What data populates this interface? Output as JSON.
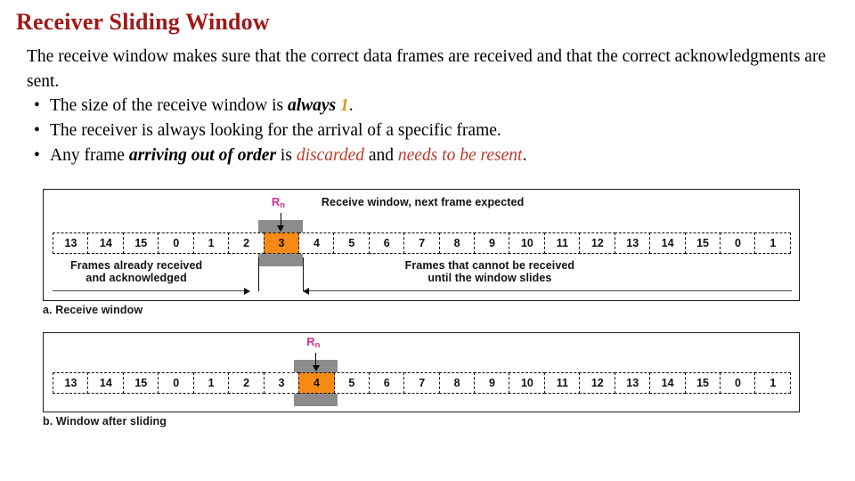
{
  "slide": {
    "title": "Receiver Sliding Window",
    "title_color": "#a01818"
  },
  "body": {
    "intro": "The receive window makes sure that the correct data frames are received and that the correct acknowledgments are sent.",
    "bullet_mark": "•",
    "bullets": [
      {
        "id": "size",
        "parts": [
          {
            "text": "The size of the receive window is ",
            "style": "normal"
          },
          {
            "text": "always ",
            "style": "bold-italic"
          },
          {
            "text": "1",
            "style": "gold-bold-italic"
          },
          {
            "text": ".",
            "style": "normal"
          }
        ]
      },
      {
        "id": "looking",
        "parts": [
          {
            "text": "The receiver is always looking for the arrival of a specific frame.",
            "style": "normal"
          }
        ]
      },
      {
        "id": "out-of-order",
        "parts": [
          {
            "text": "Any frame ",
            "style": "normal"
          },
          {
            "text": "arriving out of order",
            "style": "bold-italic"
          },
          {
            "text": " is ",
            "style": "normal"
          },
          {
            "text": "discarded",
            "style": "red-italic"
          },
          {
            "text": " and ",
            "style": "normal"
          },
          {
            "text": "needs to be resent",
            "style": "red-italic"
          },
          {
            "text": ".",
            "style": "normal"
          }
        ]
      }
    ],
    "colors": {
      "gold": "#d99a18",
      "red": "#c0392b"
    }
  },
  "figure_a": {
    "caption": "a. Receive window",
    "rn_label": "R",
    "rn_sub": "n",
    "rn_color": "#d6308f",
    "window_note": "Receive window, next frame expected",
    "left_note_line1": "Frames already received",
    "left_note_line2": "and acknowledged",
    "right_note_line1": "Frames that cannot be received",
    "right_note_line2": "until the window slides",
    "highlight_index": 6,
    "highlight_color": "#f68a14",
    "gray_color": "#8c8c8c",
    "cells": [
      "13",
      "14",
      "15",
      "0",
      "1",
      "2",
      "3",
      "4",
      "5",
      "6",
      "7",
      "8",
      "9",
      "10",
      "11",
      "12",
      "13",
      "14",
      "15",
      "0",
      "1"
    ]
  },
  "figure_b": {
    "caption": "b. Window after sliding",
    "rn_label": "R",
    "rn_sub": "n",
    "rn_color": "#d6308f",
    "highlight_index": 7,
    "highlight_color": "#f68a14",
    "gray_color": "#8c8c8c",
    "cells": [
      "13",
      "14",
      "15",
      "0",
      "1",
      "2",
      "3",
      "4",
      "5",
      "6",
      "7",
      "8",
      "9",
      "10",
      "11",
      "12",
      "13",
      "14",
      "15",
      "0",
      "1"
    ]
  }
}
